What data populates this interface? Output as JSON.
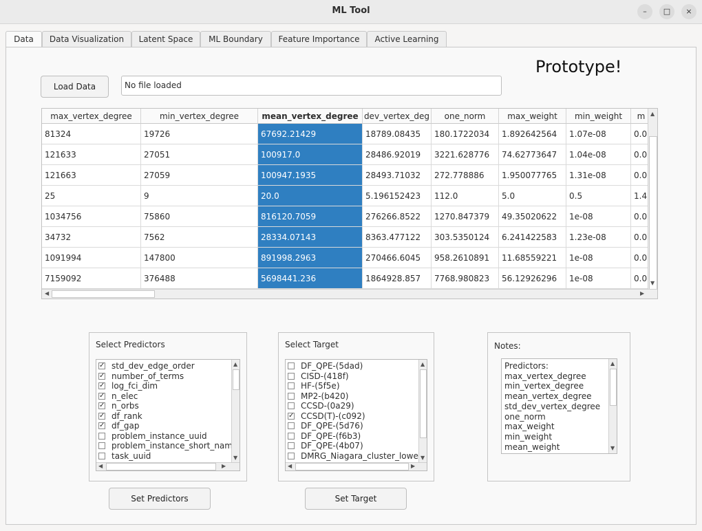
{
  "window": {
    "title": "ML Tool",
    "minimize_glyph": "–",
    "maximize_glyph": "□",
    "close_glyph": "×"
  },
  "tabs": [
    "Data",
    "Data Visualization",
    "Latent Space",
    "ML Boundary",
    "Feature Importance",
    "Active Learning"
  ],
  "active_tab": "Data",
  "prototype_label": "Prototype!",
  "load_data_button": "Load Data",
  "file_status": "No file loaded",
  "table": {
    "headers": [
      "max_vertex_degree",
      "min_vertex_degree",
      "mean_vertex_degree",
      "dev_vertex_deg",
      "one_norm",
      "max_weight",
      "min_weight",
      "m"
    ],
    "selected_column": 2,
    "rows": [
      [
        "81324",
        "19726",
        "67692.21429",
        "18789.08435",
        "180.1722034",
        "1.892642564",
        "1.07e-08",
        "0.0"
      ],
      [
        "121633",
        "27051",
        "100917.0",
        "28486.92019",
        "3221.628776",
        "74.62773647",
        "1.04e-08",
        "0.0"
      ],
      [
        "121663",
        "27059",
        "100947.1935",
        "28493.71032",
        "272.778886",
        "1.950077765",
        "1.31e-08",
        "0.0"
      ],
      [
        "25",
        "9",
        "20.0",
        "5.196152423",
        "112.0",
        "5.0",
        "0.5",
        "1.4"
      ],
      [
        "1034756",
        "75860",
        "816120.7059",
        "276266.8522",
        "1270.847379",
        "49.35020622",
        "1e-08",
        "0.0"
      ],
      [
        "34732",
        "7562",
        "28334.07143",
        "8363.477122",
        "303.5350124",
        "6.241422583",
        "1.23e-08",
        "0.0"
      ],
      [
        "1091994",
        "147800",
        "891998.2963",
        "270466.6045",
        "958.2610891",
        "11.68559221",
        "1e-08",
        "0.0"
      ],
      [
        "7159092",
        "376488",
        "5698441.236",
        "1864928.857",
        "7768.980823",
        "56.12926296",
        "1e-08",
        "0.0"
      ]
    ]
  },
  "predictors": {
    "title": "Select Predictors",
    "items": [
      {
        "label": "std_dev_edge_order",
        "checked": true
      },
      {
        "label": "number_of_terms",
        "checked": true
      },
      {
        "label": "log_fci_dim",
        "checked": true
      },
      {
        "label": "n_elec",
        "checked": true
      },
      {
        "label": "n_orbs",
        "checked": true
      },
      {
        "label": "df_rank",
        "checked": true
      },
      {
        "label": "df_gap",
        "checked": true
      },
      {
        "label": "problem_instance_uuid",
        "checked": false
      },
      {
        "label": "problem_instance_short_nam",
        "checked": false
      },
      {
        "label": "task_uuid",
        "checked": false
      }
    ],
    "button": "Set Predictors"
  },
  "target": {
    "title": "Select Target",
    "items": [
      {
        "label": "DF_QPE-(5dad)",
        "checked": false
      },
      {
        "label": "CISD-(418f)",
        "checked": false
      },
      {
        "label": "HF-(5f5e)",
        "checked": false
      },
      {
        "label": "MP2-(b420)",
        "checked": false
      },
      {
        "label": "CCSD-(0a29)",
        "checked": false
      },
      {
        "label": "CCSD(T)-(c092)",
        "checked": true
      },
      {
        "label": "DF_QPE-(5d76)",
        "checked": false
      },
      {
        "label": "DF_QPE-(f6b3)",
        "checked": false
      },
      {
        "label": "DF_QPE-(4b07)",
        "checked": false
      },
      {
        "label": "DMRG_Niagara_cluster_lowe",
        "checked": false
      }
    ],
    "button": "Set Target"
  },
  "notes": {
    "title": "Notes:",
    "lines": [
      "Predictors:",
      "max_vertex_degree",
      "min_vertex_degree",
      "mean_vertex_degree",
      "std_dev_vertex_degree",
      "one_norm",
      "max_weight",
      "min_weight",
      "mean_weight"
    ]
  },
  "colors": {
    "selection": "#2f7fc1",
    "titlebar": "#ebebeb"
  }
}
